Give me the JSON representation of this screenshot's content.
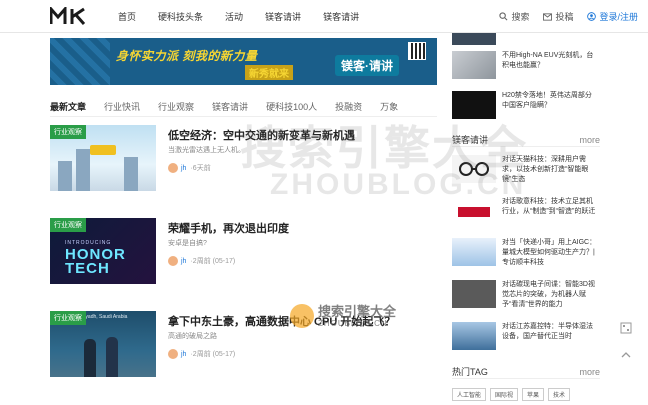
{
  "header": {
    "logo_text": "MK",
    "nav": [
      "首页",
      "硬科技头条",
      "活动",
      "镁客请讲",
      "镁客请讲"
    ],
    "search_label": "搜索",
    "submit_label": "投稿",
    "login_label": "登录/注册"
  },
  "banner": {
    "slogan": "身怀实力派 刻我的新力量",
    "sub": "新秀就来",
    "brand": "镁客·请讲"
  },
  "tabs": [
    "最新文章",
    "行业快讯",
    "行业观察",
    "镁客请讲",
    "硬科技100人",
    "投融资",
    "万象"
  ],
  "articles": [
    {
      "tag": "行业观察",
      "title": "低空经济：空中交通的新变革与新机遇",
      "subtitle": "当激光雷达遇上无人机。",
      "author": "jh",
      "time": "6天前"
    },
    {
      "tag": "行业观察",
      "title": "荣耀手机，再次退出印度",
      "subtitle": "安卓是自搞?",
      "author": "jh",
      "time": "2周前 (05-17)",
      "thumb_label": "INTRODUCING",
      "thumb_big": "HONOR TECH"
    },
    {
      "tag": "行业观察",
      "title": "拿下中东土豪，高通数据中心 CPU 开始起飞？",
      "subtitle": "高通的破局之路",
      "author": "jh",
      "time": "2周前 (05-17)",
      "thumb_label": "| Riyadh, Saudi Arabia"
    }
  ],
  "sidebar": {
    "top_items": [
      {
        "text": ""
      },
      {
        "text": "不用High-NA EUV光刻机，台积电也能赢？"
      },
      {
        "text": "H20禁令落地！英伟达周部分中国客户隐瞒？"
      }
    ],
    "section_title": "镁客请讲",
    "more_label": "more",
    "items": [
      {
        "text": "对话天猫科技：深耕用户需求，以技术创新打造“智能眼镜”生态"
      },
      {
        "text": "对话歌意科技：技术立足其机行业，从“制造”到“智造”的跃迁"
      },
      {
        "text": "对当「快递小哥」用上AIGC：量城大模型如何驱动生产力？| 专访顺丰科技"
      },
      {
        "text": "对话碳现电子间谍：智能3D视觉芯片的突破，为机器人赋予“看清”世界的能力"
      },
      {
        "text": "对话江苏嘉控特：半导体湿法设备，国产替代正当时"
      }
    ],
    "tags_title": "热门TAG",
    "tags_more": "more",
    "tags": [
      "人工智能",
      "国际视",
      "苹果",
      "技术"
    ]
  },
  "watermark": {
    "big_cn": "搜索引擎大全",
    "big_en": "ZHOUBLOG.CN",
    "stamp_cn": "搜索引擎大全",
    "stamp_en": "ZHOUBLOG.CN"
  }
}
